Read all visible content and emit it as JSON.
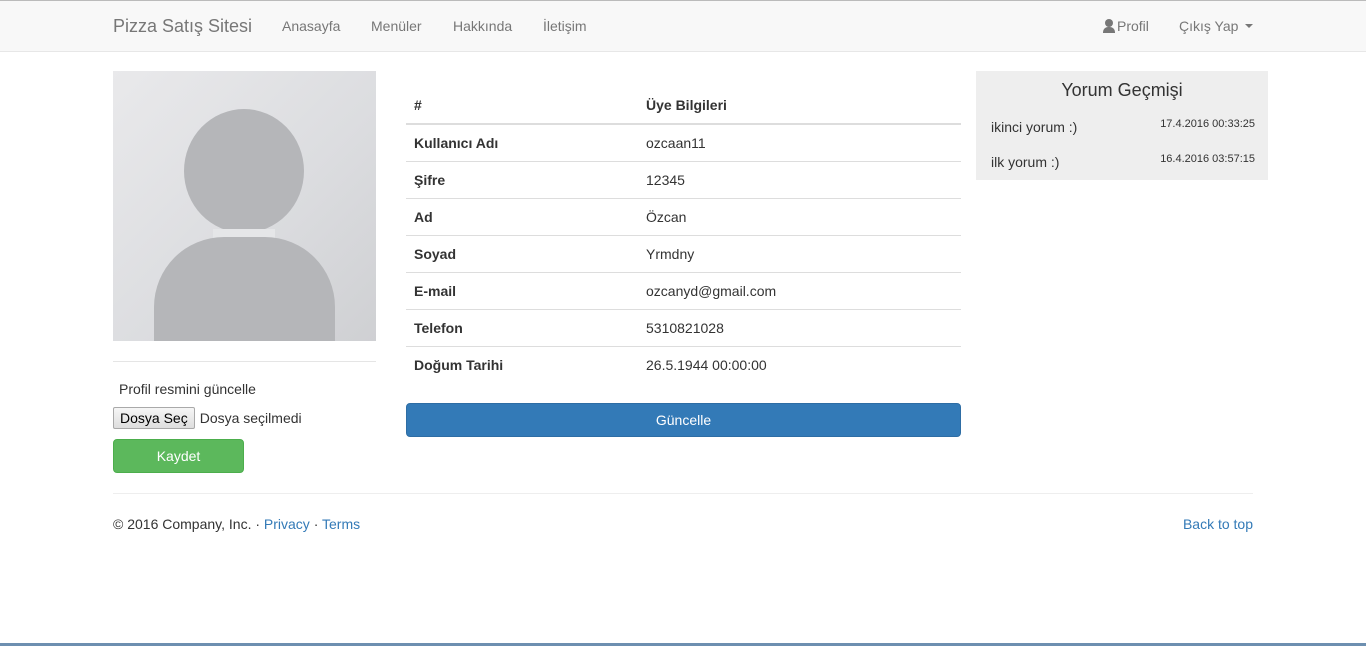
{
  "navbar": {
    "brand": "Pizza Satış Sitesi",
    "links": [
      "Anasayfa",
      "Menüler",
      "Hakkında",
      "İletişim"
    ],
    "profile_label": "Profil",
    "logout_label": "Çıkış Yap"
  },
  "profile_image": {
    "upload_label": "Profil resmini güncelle",
    "file_button_label": "Dosya Seç",
    "file_status": "Dosya seçilmedi",
    "save_label": "Kaydet"
  },
  "member_table": {
    "headers": [
      "#",
      "Üye Bilgileri"
    ],
    "rows": [
      {
        "label": "Kullanıcı Adı",
        "value": "ozcaan11"
      },
      {
        "label": "Şifre",
        "value": "12345"
      },
      {
        "label": "Ad",
        "value": "Özcan"
      },
      {
        "label": "Soyad",
        "value": "Yrmdny"
      },
      {
        "label": "E-mail",
        "value": "ozcanyd@gmail.com"
      },
      {
        "label": "Telefon",
        "value": "5310821028"
      },
      {
        "label": "Doğum Tarihi",
        "value": "26.5.1944 00:00:00"
      }
    ],
    "update_label": "Güncelle"
  },
  "comment_history": {
    "title": "Yorum Geçmişi",
    "items": [
      {
        "text": "ikinci yorum :)",
        "date": "17.4.2016 00:33:25"
      },
      {
        "text": "ilk yorum :)",
        "date": "16.4.2016 03:57:15"
      }
    ]
  },
  "footer": {
    "copyright": "© 2016 Company, Inc. · ",
    "privacy": "Privacy",
    "separator": " · ",
    "terms": "Terms",
    "back_to_top": "Back to top"
  }
}
